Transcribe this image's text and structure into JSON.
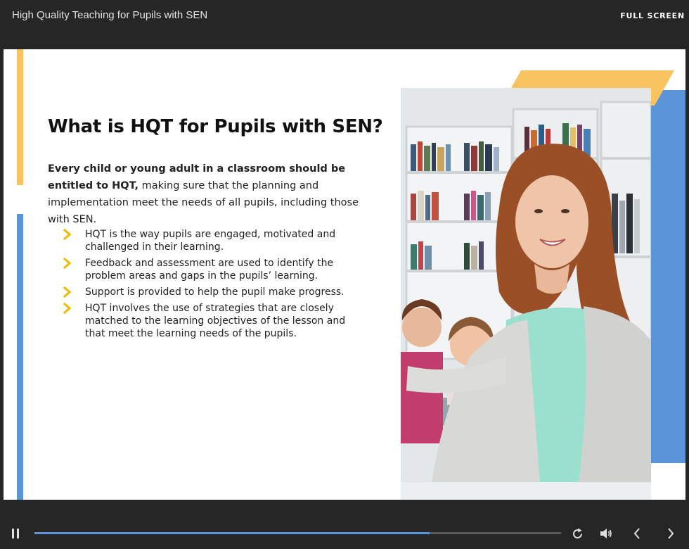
{
  "header": {
    "title": "High Quality Teaching for Pupils with SEN",
    "fullscreen_label": "FULL SCREEN"
  },
  "slide": {
    "heading": "What is HQT for Pupils with SEN?",
    "intro_bold": "Every child or young adult in a classroom should be entitled to HQT,",
    "intro_rest": " making sure that the planning and implementation meet the needs of all pupils, including those with SEN.",
    "bullets": [
      "HQT is the way pupils are engaged, motivated and challenged in their learning.",
      "Feedback and assessment are used to identify the problem areas and gaps in the pupils’ learning.",
      "Support is provided to help the pupil make progress.",
      "HQT involves the use of strategies that are closely matched to the learning objectives of the lesson and that meet the learning needs of the pupils."
    ],
    "image": "teacher-with-children-in-library-photo"
  },
  "player": {
    "progress_fraction": 0.75,
    "icons": [
      "pause-icon",
      "replay-icon",
      "volume-icon",
      "previous-icon",
      "next-icon"
    ]
  },
  "colors": {
    "accent_yellow": "#f9c361",
    "accent_blue": "#5b95d8",
    "bullet_chevron": "#f2b800",
    "chrome": "#262626"
  }
}
